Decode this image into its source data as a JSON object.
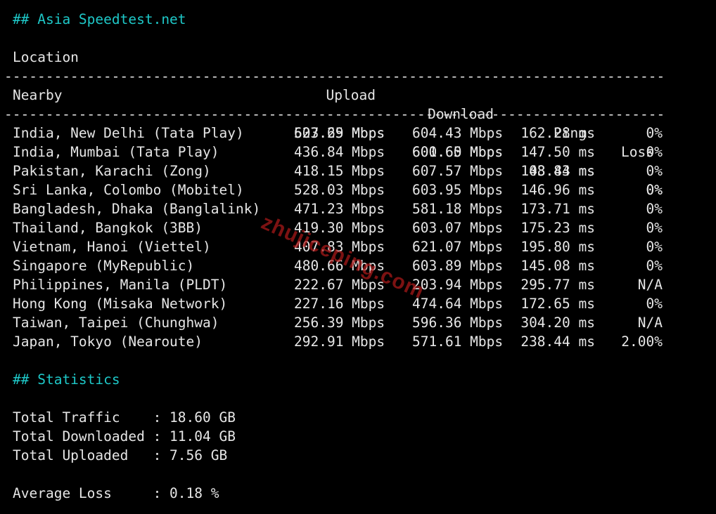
{
  "sections": {
    "speedtest_title": "## Asia Speedtest.net",
    "stats_title": "## Statistics"
  },
  "table": {
    "headers": {
      "location": "Location",
      "upload": "Upload",
      "download": "Download",
      "ping": "Ping",
      "loss": "Loss"
    },
    "separator": "--------------------------------------------------------------------------------",
    "nearby": {
      "location": "Nearby",
      "upload": "623.69 Mbps",
      "download": "601.65 Mbps",
      "ping": "43.43 ms",
      "loss": "0%"
    },
    "rows": [
      {
        "location": "India, New Delhi (Tata Play)",
        "upload": "507.25 Mbps",
        "download": "604.43 Mbps",
        "ping": "162.28 ms",
        "loss": "0%"
      },
      {
        "location": "India, Mumbai (Tata Play)",
        "upload": "436.84 Mbps",
        "download": "600.60 Mbps",
        "ping": "147.50 ms",
        "loss": "0%"
      },
      {
        "location": "Pakistan, Karachi (Zong)",
        "upload": "418.15 Mbps",
        "download": "607.57 Mbps",
        "ping": "108.84 ms",
        "loss": "0%"
      },
      {
        "location": "Sri Lanka, Colombo (Mobitel)",
        "upload": "528.03 Mbps",
        "download": "603.95 Mbps",
        "ping": "146.96 ms",
        "loss": "0%"
      },
      {
        "location": "Bangladesh, Dhaka (Banglalink)",
        "upload": "471.23 Mbps",
        "download": "581.18 Mbps",
        "ping": "173.71 ms",
        "loss": "0%"
      },
      {
        "location": "Thailand, Bangkok (3BB)",
        "upload": "419.30 Mbps",
        "download": "603.07 Mbps",
        "ping": "175.23 ms",
        "loss": "0%"
      },
      {
        "location": "Vietnam, Hanoi (Viettel)",
        "upload": "407.83 Mbps",
        "download": "621.07 Mbps",
        "ping": "195.80 ms",
        "loss": "0%"
      },
      {
        "location": "Singapore (MyRepublic)",
        "upload": "480.66 Mbps",
        "download": "603.89 Mbps",
        "ping": "145.08 ms",
        "loss": "0%"
      },
      {
        "location": "Philippines, Manila (PLDT)",
        "upload": "222.67 Mbps",
        "download": "203.94 Mbps",
        "ping": "295.77 ms",
        "loss": "N/A"
      },
      {
        "location": "Hong Kong (Misaka Network)",
        "upload": "227.16 Mbps",
        "download": "474.64 Mbps",
        "ping": "172.65 ms",
        "loss": "0%"
      },
      {
        "location": "Taiwan, Taipei (Chunghwa)",
        "upload": "256.39 Mbps",
        "download": "596.36 Mbps",
        "ping": "304.20 ms",
        "loss": "N/A"
      },
      {
        "location": "Japan, Tokyo (Nearoute)",
        "upload": "292.91 Mbps",
        "download": "571.61 Mbps",
        "ping": "238.44 ms",
        "loss": "2.00%"
      }
    ]
  },
  "statistics": {
    "total_traffic": "Total Traffic    : 18.60 GB",
    "total_downloaded": "Total Downloaded : 11.04 GB",
    "total_uploaded": "Total Uploaded   : 7.56 GB",
    "average_loss": "Average Loss     : 0.18 %"
  },
  "watermark": "zhujiceping.com",
  "colors": {
    "background": "#000000",
    "text": "#e6e6e6",
    "heading": "#1ec8c8",
    "watermark": "#b11a1a"
  }
}
